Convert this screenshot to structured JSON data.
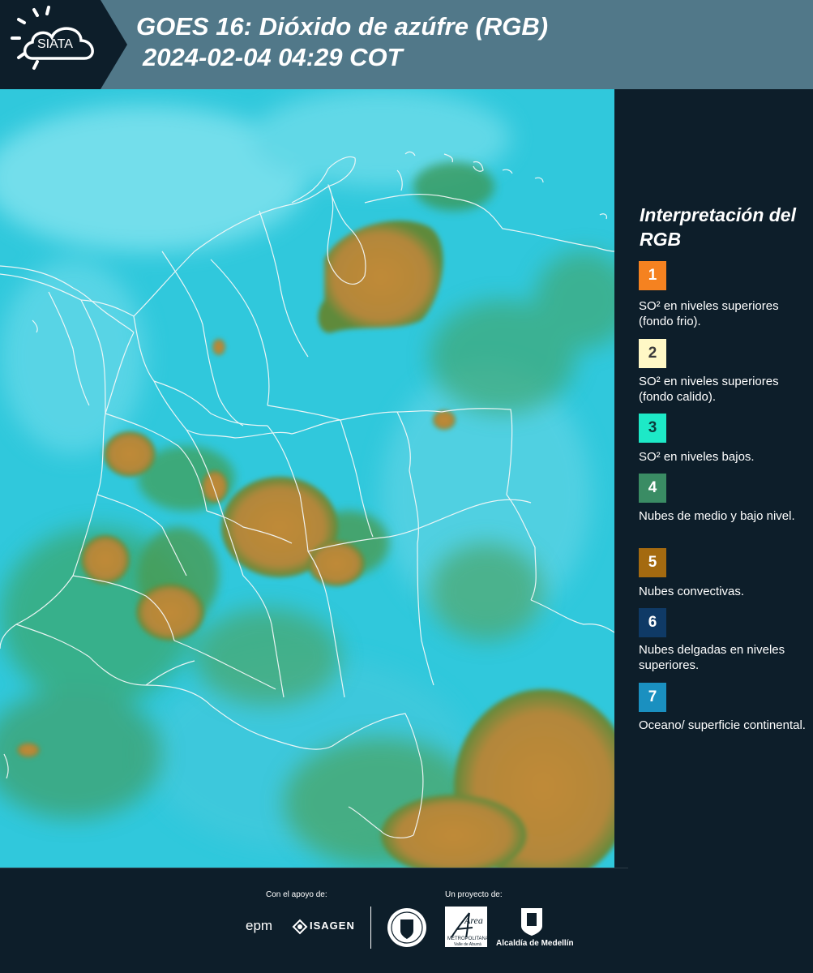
{
  "header": {
    "logo_text": "SIATA",
    "title_line1": "GOES 16: Dióxido de azúfre (RGB)",
    "title_line2": "2024-02-04 04:29 COT"
  },
  "legend": {
    "title": "Interpretación del RGB",
    "items": [
      {
        "number": "1",
        "color": "#f58220",
        "text_color": "#ffffff",
        "description": "SO² en niveles superiores (fondo frio)."
      },
      {
        "number": "2",
        "color": "#fff8c6",
        "text_color": "#3a3a3a",
        "description": "SO² en niveles superiores (fondo calido)."
      },
      {
        "number": "3",
        "color": "#1de9c7",
        "text_color": "#0b3b3b",
        "description": "SO² en niveles bajos."
      },
      {
        "number": "4",
        "color": "#3a8c64",
        "text_color": "#ffffff",
        "description": "Nubes de medio y bajo nivel."
      },
      {
        "number": "5",
        "color": "#a46a10",
        "text_color": "#ffffff",
        "description": "Nubes convectivas."
      },
      {
        "number": "6",
        "color": "#0f3a66",
        "text_color": "#ffffff",
        "description": "Nubes delgadas en niveles superiores."
      },
      {
        "number": "7",
        "color": "#1a90c0",
        "text_color": "#ffffff",
        "description": "Oceano/ superficie continental."
      }
    ]
  },
  "footer": {
    "support_label": "Con el apoyo de:",
    "project_label": "Un proyecto de:",
    "sponsor_epm": "epm",
    "sponsor_isagen": "ISAGEN",
    "metropolitana_name": "Área",
    "metropolitana_sub": "METROPOLITANA",
    "metropolitana_sub2": "Valle de Aburrá",
    "alcaldia": "Alcaldía de Medellín"
  },
  "colors": {
    "header_bg": "#517889",
    "page_bg": "#0d1e2a",
    "map_background": "#2ec6da",
    "cloud_convective": "#b58a34",
    "cloud_low": "#3a9a5a"
  }
}
